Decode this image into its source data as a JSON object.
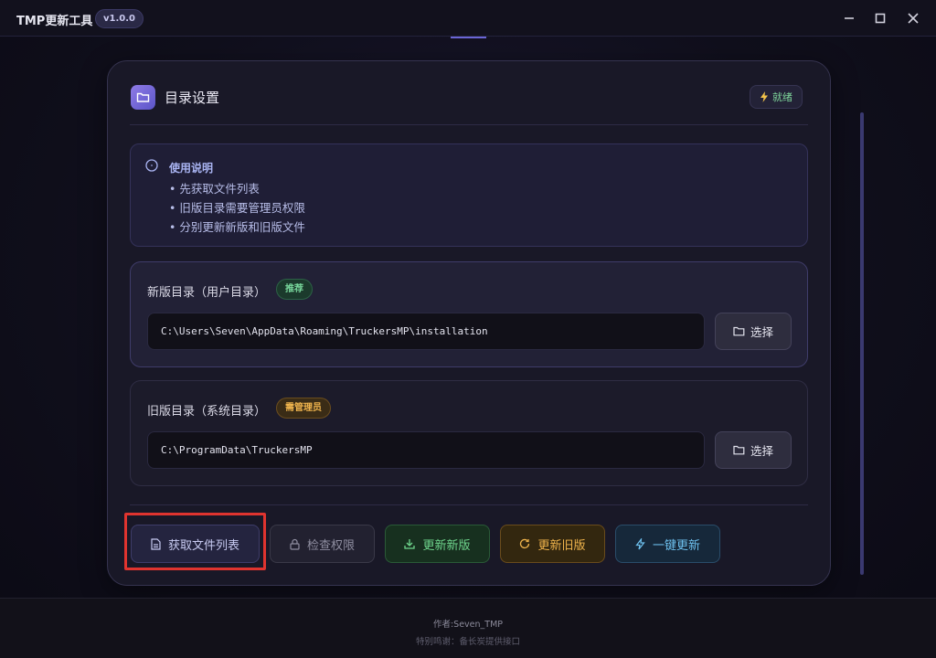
{
  "window": {
    "title": "TMP更新工具",
    "version": "v1.0.0"
  },
  "card": {
    "title": "目录设置",
    "status": "就绪"
  },
  "info": {
    "title": "使用说明",
    "lines": [
      "• 先获取文件列表",
      "• 旧版目录需要管理员权限",
      "• 分别更新新版和旧版文件"
    ]
  },
  "new_dir": {
    "label": "新版目录（用户目录）",
    "tag": "推荐",
    "path": "C:\\Users\\Seven\\AppData\\Roaming\\TruckersMP\\installation",
    "choose_label": "选择"
  },
  "old_dir": {
    "label": "旧版目录（系统目录）",
    "tag": "需管理员",
    "path": "C:\\ProgramData\\TruckersMP",
    "choose_label": "选择"
  },
  "actions": {
    "fetch": "获取文件列表",
    "check": "检查权限",
    "update_new": "更新新版",
    "update_old": "更新旧版",
    "update_all": "一键更新"
  },
  "footer": {
    "author": "作者:Seven_TMP",
    "thanks": "特别鸣谢：备长炭提供接口"
  },
  "colors": {
    "accent": "#6b66d6",
    "success": "#6fd68d",
    "warning": "#f0b44c",
    "info": "#6ec1ef",
    "highlight": "#e0342f"
  },
  "icons": {
    "status": "lightning-icon",
    "folder": "folder-icon",
    "info": "info-circle-icon",
    "fetch": "document-icon",
    "check": "lock-icon",
    "update_new": "download-icon",
    "update_old": "refresh-icon",
    "update_all": "lightning-icon"
  }
}
